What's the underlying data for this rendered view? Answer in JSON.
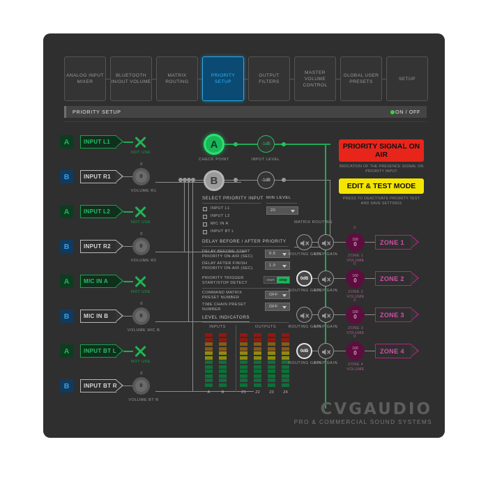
{
  "tabs": [
    {
      "label": "ANALOG INPUT MIXER",
      "active": false
    },
    {
      "label": "BLUETOOTH IN/OUT VOLUME",
      "active": false
    },
    {
      "label": "MATRIX ROUTING",
      "active": false
    },
    {
      "label": "PRIORITY SETUP",
      "active": true
    },
    {
      "label": "OUTPUT FILTERS",
      "active": false
    },
    {
      "label": "MASTER VOLUME CONTROL",
      "active": false
    },
    {
      "label": "GLOBAL USER PRESETS",
      "active": false
    },
    {
      "label": "SETUP",
      "active": false
    }
  ],
  "subheader": {
    "title": "PRIORITY SETUP",
    "onoff": "ON / OFF"
  },
  "inputs": [
    {
      "badge": "A",
      "name": "INPUT L1",
      "state": "green",
      "note": "NOT USE"
    },
    {
      "badge": "B",
      "name": "INPUT R1",
      "state": "normal",
      "knob_top": "0",
      "knob_value": "0",
      "knob_label": "VOLUME R1"
    },
    {
      "badge": "A",
      "name": "INPUT L2",
      "state": "green",
      "note": "NOT USE"
    },
    {
      "badge": "B",
      "name": "INPUT R2",
      "state": "normal",
      "knob_top": "0",
      "knob_value": "0",
      "knob_label": "VOLUME R2"
    },
    {
      "badge": "A",
      "name": "MIC IN A",
      "state": "green",
      "note": "NOT USE"
    },
    {
      "badge": "B",
      "name": "MIC IN B",
      "state": "normal",
      "knob_top": "0",
      "knob_value": "0",
      "knob_label": "VOLUME MIC B"
    },
    {
      "badge": "A",
      "name": "INPUT BT L",
      "state": "green",
      "note": "NOT USE"
    },
    {
      "badge": "B",
      "name": "INPUT BT R",
      "state": "normal",
      "knob_top": "0",
      "knob_value": "0",
      "knob_label": "VOLUME BT R"
    }
  ],
  "center": {
    "checkpoint_a": "A",
    "checkpoint_b": "B",
    "checkpoint_label": "CHECK POINT",
    "level_a": "-1dB",
    "level_b": "-1dB",
    "input_level_label": "INPUT LEVEL",
    "select_priority_title": "SELECT PRIORITY INPUT",
    "priority_options": [
      "INPUT L1",
      "INPUT L2",
      "MIC IN A",
      "INPUT BT L"
    ],
    "min_level_title": "MIN LEVEL",
    "min_level_value": "20",
    "delay_title": "DELAY BEFORE / AFTER PRIORITY",
    "delay_before_label": "DELAY BEFORE START PRIORITY ON-AIR (SEC)",
    "delay_before_value": "0.5",
    "delay_after_label": "DELAY AFTER FINISH PRIORITY ON-AIR (SEC)",
    "delay_after_value": "1.0",
    "trigger_label": "PRIORITY TRIGGER START/STOP DETECT",
    "trigger_start": "start",
    "trigger_stop": "stop",
    "command_matrix_label": "COMMAND MATRIX PRESET NUMBER",
    "command_matrix_value": "OFF",
    "time_chain_label": "TIME CHAIN PRESET NUMBER",
    "time_chain_value": "OFF",
    "level_indicators_title": "LEVEL INDICATORS",
    "inputs_group": "INPUTS",
    "outputs_group": "OUTPUTS",
    "meter_labels": [
      "A",
      "B",
      "Z1",
      "Z2",
      "Z3",
      "Z4"
    ]
  },
  "right": {
    "matrix_routing_label": "MATRIX ROUTING",
    "priority_banner": "PRIORITY SIGNAL ON AIR",
    "priority_banner_sub": "INDICATION OF THE PRESENCE SIGNAL ON PRIORITY INPUT",
    "edit_banner": "EDIT & TEST MODE",
    "edit_banner_sub": "PRESS TO DEACTIVATE PRIORITY TEST AND SAVE SETTINGS",
    "routing_gain_label": "ROUTING GAIN",
    "step_gain_label": "STEP GAIN",
    "zones": [
      {
        "name": "ZONE 1",
        "routing_gain": "mute",
        "step_gain": "mute",
        "vol_top": "0",
        "vol_max": "100",
        "vol_value": "0",
        "vol_label": "ZONE 1 VOLUME"
      },
      {
        "name": "ZONE 2",
        "routing_gain": "0dB",
        "step_gain": "mute",
        "vol_top": "0",
        "vol_max": "100",
        "vol_value": "0",
        "vol_label": "ZONE 2 VOLUME"
      },
      {
        "name": "ZONE 3",
        "routing_gain": "mute",
        "step_gain": "mute",
        "vol_top": "0",
        "vol_max": "100",
        "vol_value": "0",
        "vol_label": "ZONE 3 VOLUME"
      },
      {
        "name": "ZONE 4",
        "routing_gain": "0dB",
        "step_gain": "mute",
        "vol_top": "0",
        "vol_max": "100",
        "vol_value": "0",
        "vol_label": "ZONE 4 VOLUME"
      }
    ]
  },
  "logo": {
    "name": "CVGAUDIO",
    "tagline": "PRO & COMMERCIAL SOUND SYSTEMS"
  },
  "colors": {
    "accent_green": "#19b95b",
    "accent_blue": "#2fb6f5",
    "magenta": "#b4247f",
    "red": "#e8251b",
    "yellow": "#f5e400"
  }
}
